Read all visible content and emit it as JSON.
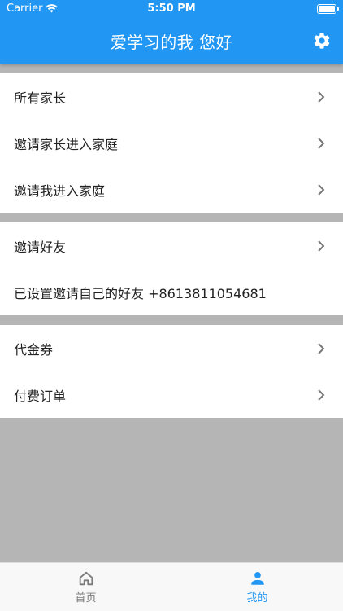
{
  "status_bar": {
    "carrier": "Carrier",
    "time": "5:50 PM"
  },
  "header": {
    "title": "爱学习的我 您好"
  },
  "sections": [
    {
      "items": [
        {
          "label": "所有家长"
        },
        {
          "label": "邀请家长进入家庭"
        },
        {
          "label": "邀请我进入家庭"
        }
      ]
    },
    {
      "items": [
        {
          "label": "邀请好友"
        },
        {
          "label": "已设置邀请自己的好友 +8613811054681"
        }
      ]
    },
    {
      "items": [
        {
          "label": "代金券"
        },
        {
          "label": "付费订单"
        }
      ]
    }
  ],
  "tabs": [
    {
      "label": "首页",
      "icon": "home-icon",
      "active": false
    },
    {
      "label": "我的",
      "icon": "person-icon",
      "active": true
    }
  ],
  "colors": {
    "accent": "#2196f3",
    "background": "#b5b5b5"
  }
}
